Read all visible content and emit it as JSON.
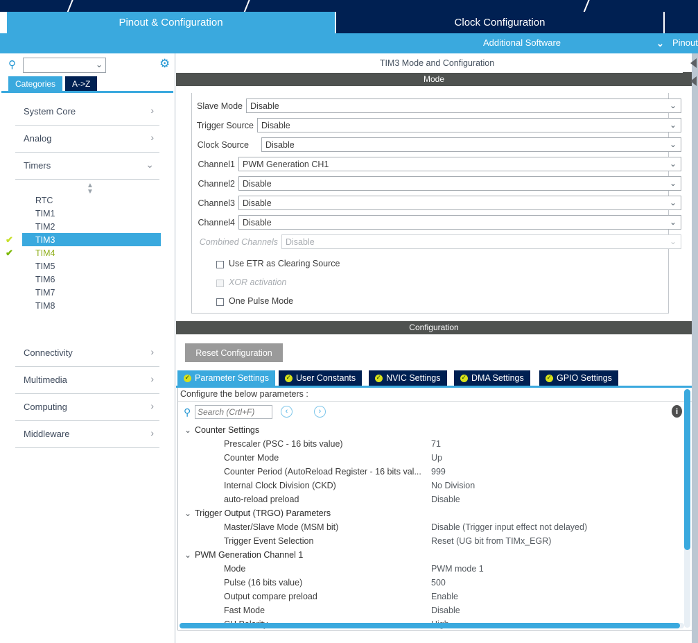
{
  "window": {
    "main_tabs": [
      {
        "label": "Pinout & Configuration",
        "active": true
      },
      {
        "label": "Clock Configuration",
        "active": false
      },
      {
        "label": "",
        "active": false
      }
    ],
    "subbar": {
      "additional_software": "Additional Software",
      "pinout_view": "Pinout",
      "chevron": "⌄"
    }
  },
  "sidebar": {
    "search": {
      "value": "",
      "caret": "⌄"
    },
    "gear_icon": "gear-icon",
    "search_icon": "search-icon",
    "tabs": [
      {
        "label": "Categories",
        "active": true
      },
      {
        "label": "A->Z",
        "active": false
      }
    ],
    "categories": [
      {
        "label": "System Core",
        "chevron": "›",
        "expanded": false
      },
      {
        "label": "Analog",
        "chevron": "›",
        "expanded": false
      },
      {
        "label": "Timers",
        "chevron": "⌄",
        "expanded": true
      }
    ],
    "timers": [
      {
        "label": "RTC",
        "state": "none"
      },
      {
        "label": "TIM1",
        "state": "none"
      },
      {
        "label": "TIM2",
        "state": "none"
      },
      {
        "label": "TIM3",
        "state": "selected",
        "check": "✔"
      },
      {
        "label": "TIM4",
        "state": "configured",
        "check": "✔"
      },
      {
        "label": "TIM5",
        "state": "none"
      },
      {
        "label": "TIM6",
        "state": "none"
      },
      {
        "label": "TIM7",
        "state": "none"
      },
      {
        "label": "TIM8",
        "state": "none"
      }
    ],
    "categories_bottom": [
      {
        "label": "Connectivity",
        "chevron": "›"
      },
      {
        "label": "Multimedia",
        "chevron": "›"
      },
      {
        "label": "Computing",
        "chevron": "›"
      },
      {
        "label": "Middleware",
        "chevron": "›"
      }
    ]
  },
  "panel": {
    "title": "TIM3 Mode and Configuration",
    "mode_header": "Mode",
    "config_header": "Configuration",
    "mode_rows": [
      {
        "label": "Slave Mode",
        "value": "Disable",
        "disabled": false
      },
      {
        "label": "Trigger Source",
        "value": "Disable",
        "disabled": false
      },
      {
        "label": "Clock Source",
        "value": "Disable",
        "disabled": false
      },
      {
        "label": "Channel1",
        "value": "PWM Generation CH1",
        "disabled": false
      },
      {
        "label": "Channel2",
        "value": "Disable",
        "disabled": false
      },
      {
        "label": "Channel3",
        "value": "Disable",
        "disabled": false
      },
      {
        "label": "Channel4",
        "value": "Disable",
        "disabled": false
      },
      {
        "label": "Combined Channels",
        "value": "Disable",
        "disabled": true
      }
    ],
    "checkboxes": [
      {
        "label": "Use ETR as Clearing Source",
        "checked": false,
        "disabled": false
      },
      {
        "label": "XOR activation",
        "checked": false,
        "disabled": true
      },
      {
        "label": "One Pulse Mode",
        "checked": false,
        "disabled": false
      }
    ],
    "reset_button": "Reset Configuration",
    "config_tabs": [
      {
        "label": "Parameter Settings",
        "active": true
      },
      {
        "label": "User Constants",
        "active": false
      },
      {
        "label": "NVIC Settings",
        "active": false
      },
      {
        "label": "DMA Settings",
        "active": false
      },
      {
        "label": "GPIO Settings",
        "active": false
      }
    ],
    "configure_note": "Configure the below parameters :",
    "param_search": {
      "placeholder": "Search (Crtl+F)",
      "value": ""
    },
    "nav_prev": "‹",
    "nav_next": "›",
    "info_icon": "info-icon",
    "groups": [
      {
        "name": "Counter Settings",
        "chevron": "⌄",
        "rows": [
          {
            "name": "Prescaler (PSC - 16 bits value)",
            "value": "71"
          },
          {
            "name": "Counter Mode",
            "value": "Up"
          },
          {
            "name": "Counter Period (AutoReload Register - 16 bits val...",
            "value": "999"
          },
          {
            "name": "Internal Clock Division (CKD)",
            "value": "No Division"
          },
          {
            "name": "auto-reload preload",
            "value": "Disable"
          }
        ]
      },
      {
        "name": "Trigger Output (TRGO) Parameters",
        "chevron": "⌄",
        "rows": [
          {
            "name": "Master/Slave Mode (MSM bit)",
            "value": "Disable (Trigger input effect not delayed)"
          },
          {
            "name": "Trigger Event Selection",
            "value": "Reset (UG bit from TIMx_EGR)"
          }
        ]
      },
      {
        "name": "PWM Generation Channel 1",
        "chevron": "⌄",
        "rows": [
          {
            "name": "Mode",
            "value": "PWM mode 1"
          },
          {
            "name": "Pulse (16 bits value)",
            "value": "500"
          },
          {
            "name": "Output compare preload",
            "value": "Enable"
          },
          {
            "name": "Fast Mode",
            "value": "Disable"
          },
          {
            "name": "CH Polarity",
            "value": "High"
          }
        ]
      }
    ]
  },
  "colors": {
    "accent_blue": "#3aa9de",
    "navy": "#002052",
    "band_grey": "#4f5250",
    "check_green": "#7ab800",
    "configured_text": "#8fae1b",
    "tab_dot": "#d7e11c"
  }
}
